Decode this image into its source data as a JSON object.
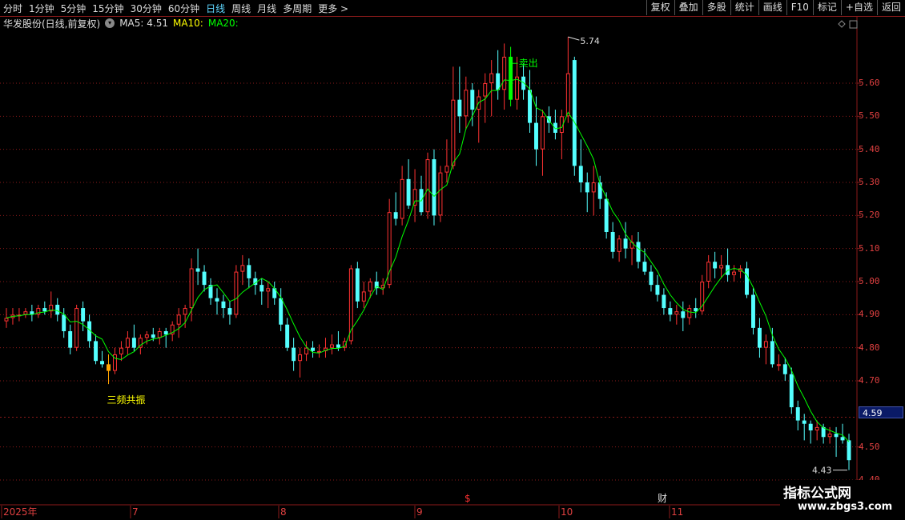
{
  "toolbar": {
    "periods": [
      "分时",
      "1分钟",
      "5分钟",
      "15分钟",
      "30分钟",
      "60分钟",
      "日线",
      "周线",
      "月线",
      "多周期",
      "更多 >"
    ],
    "active_period": "日线",
    "buttons": [
      "复权",
      "叠加",
      "多股",
      "统计",
      "画线",
      "F10",
      "标记",
      "+自选",
      "返回"
    ]
  },
  "info": {
    "stock_name": "华发股份(日线,前复权)",
    "ma5_label": "MA5: 4.51",
    "ma10_label": "MA10:",
    "ma20_label": "MA20:"
  },
  "price_axis": {
    "ticks": [
      "5.60",
      "5.50",
      "5.40",
      "5.30",
      "5.20",
      "5.10",
      "5.00",
      "4.90",
      "4.80",
      "4.70",
      "4.50",
      "4.40"
    ]
  },
  "current_price": "4.59",
  "time_axis": {
    "labels": [
      "2025年",
      "7",
      "8",
      "9",
      "10",
      "11"
    ],
    "event_markers": [
      "$",
      "财"
    ]
  },
  "annotations": {
    "high_label": "5.74",
    "low_label": "4.43",
    "buy_signal": "三频共振",
    "sell_signal": "卖出"
  },
  "watermark": {
    "line1": "指标公式网",
    "line2": "www.zbgs3.com"
  },
  "colors": {
    "up": "#ff3232",
    "down": "#54ffff",
    "ma": "#00ff00",
    "grid": "#8b1a1a",
    "signal_buy": "#ffa500",
    "signal_sell": "#00ff00"
  },
  "chart_data": {
    "type": "candlestick",
    "y_range": [
      4.4,
      5.75
    ],
    "series": [
      {
        "name": "candles",
        "values": [
          [
            4.88,
            4.92,
            4.86,
            4.89
          ],
          [
            4.89,
            4.92,
            4.87,
            4.9
          ],
          [
            4.9,
            4.92,
            4.88,
            4.9
          ],
          [
            4.9,
            4.92,
            4.89,
            4.91
          ],
          [
            4.91,
            4.93,
            4.88,
            4.9
          ],
          [
            4.9,
            4.93,
            4.89,
            4.92
          ],
          [
            4.92,
            4.94,
            4.9,
            4.91
          ],
          [
            4.91,
            4.97,
            4.89,
            4.93
          ],
          [
            4.93,
            4.95,
            4.88,
            4.9
          ],
          [
            4.9,
            4.92,
            4.83,
            4.85
          ],
          [
            4.85,
            4.87,
            4.78,
            4.8
          ],
          [
            4.8,
            4.93,
            4.79,
            4.92
          ],
          [
            4.92,
            4.94,
            4.85,
            4.88
          ],
          [
            4.88,
            4.9,
            4.8,
            4.82
          ],
          [
            4.82,
            4.84,
            4.75,
            4.76
          ],
          [
            4.76,
            4.79,
            4.74,
            4.75
          ],
          [
            4.75,
            4.78,
            4.69,
            4.73
          ],
          [
            4.73,
            4.8,
            4.72,
            4.78
          ],
          [
            4.78,
            4.82,
            4.76,
            4.8
          ],
          [
            4.8,
            4.85,
            4.78,
            4.83
          ],
          [
            4.83,
            4.87,
            4.79,
            4.8
          ],
          [
            4.8,
            4.84,
            4.78,
            4.83
          ],
          [
            4.83,
            4.85,
            4.81,
            4.84
          ],
          [
            4.84,
            4.86,
            4.82,
            4.83
          ],
          [
            4.83,
            4.86,
            4.81,
            4.85
          ],
          [
            4.85,
            4.86,
            4.8,
            4.84
          ],
          [
            4.84,
            4.88,
            4.82,
            4.87
          ],
          [
            4.87,
            4.92,
            4.83,
            4.9
          ],
          [
            4.9,
            4.93,
            4.86,
            4.92
          ],
          [
            4.92,
            5.07,
            4.88,
            5.04
          ],
          [
            5.04,
            5.1,
            4.99,
            5.03
          ],
          [
            5.03,
            5.05,
            4.97,
            4.99
          ],
          [
            4.99,
            5.01,
            4.93,
            4.95
          ],
          [
            4.95,
            4.98,
            4.9,
            4.94
          ],
          [
            4.94,
            4.96,
            4.89,
            4.92
          ],
          [
            4.92,
            4.94,
            4.87,
            4.9
          ],
          [
            4.9,
            5.05,
            4.89,
            5.03
          ],
          [
            5.03,
            5.08,
            4.99,
            5.05
          ],
          [
            5.05,
            5.07,
            4.98,
            5.01
          ],
          [
            5.01,
            5.03,
            4.96,
            4.99
          ],
          [
            4.99,
            5.01,
            4.93,
            4.97
          ],
          [
            4.97,
            5.0,
            4.92,
            4.98
          ],
          [
            4.98,
            5.0,
            4.93,
            4.95
          ],
          [
            4.95,
            4.98,
            4.85,
            4.87
          ],
          [
            4.87,
            4.89,
            4.79,
            4.8
          ],
          [
            4.8,
            4.83,
            4.73,
            4.76
          ],
          [
            4.76,
            4.8,
            4.71,
            4.78
          ],
          [
            4.78,
            4.82,
            4.76,
            4.8
          ],
          [
            4.8,
            4.82,
            4.77,
            4.79
          ],
          [
            4.79,
            4.81,
            4.77,
            4.79
          ],
          [
            4.79,
            4.83,
            4.77,
            4.8
          ],
          [
            4.8,
            4.84,
            4.78,
            4.81
          ],
          [
            4.81,
            4.85,
            4.79,
            4.8
          ],
          [
            4.8,
            4.83,
            4.79,
            4.82
          ],
          [
            4.82,
            5.05,
            4.81,
            5.04
          ],
          [
            5.04,
            5.06,
            4.92,
            4.94
          ],
          [
            4.94,
            5.0,
            4.92,
            4.97
          ],
          [
            4.97,
            5.01,
            4.95,
            5.0
          ],
          [
            5.0,
            5.03,
            4.96,
            4.98
          ],
          [
            4.98,
            5.01,
            4.96,
            4.99
          ],
          [
            4.99,
            5.25,
            4.98,
            5.21
          ],
          [
            5.21,
            5.27,
            5.17,
            5.19
          ],
          [
            5.19,
            5.35,
            5.17,
            5.31
          ],
          [
            5.31,
            5.37,
            5.22,
            5.23
          ],
          [
            5.23,
            5.34,
            5.18,
            5.28
          ],
          [
            5.28,
            5.32,
            5.2,
            5.21
          ],
          [
            5.21,
            5.39,
            5.19,
            5.37
          ],
          [
            5.37,
            5.4,
            5.17,
            5.2
          ],
          [
            5.2,
            5.35,
            5.18,
            5.33
          ],
          [
            5.33,
            5.43,
            5.3,
            5.35
          ],
          [
            5.35,
            5.65,
            5.34,
            5.55
          ],
          [
            5.55,
            5.65,
            5.45,
            5.5
          ],
          [
            5.5,
            5.62,
            5.46,
            5.58
          ],
          [
            5.58,
            5.6,
            5.47,
            5.52
          ],
          [
            5.52,
            5.58,
            5.42,
            5.56
          ],
          [
            5.56,
            5.63,
            5.48,
            5.6
          ],
          [
            5.6,
            5.67,
            5.5,
            5.63
          ],
          [
            5.63,
            5.7,
            5.55,
            5.58
          ],
          [
            5.58,
            5.72,
            5.52,
            5.68
          ],
          [
            5.68,
            5.71,
            5.53,
            5.55
          ],
          [
            5.55,
            5.68,
            5.52,
            5.62
          ],
          [
            5.62,
            5.66,
            5.55,
            5.58
          ],
          [
            5.58,
            5.64,
            5.45,
            5.48
          ],
          [
            5.48,
            5.56,
            5.35,
            5.4
          ],
          [
            5.4,
            5.52,
            5.32,
            5.5
          ],
          [
            5.5,
            5.53,
            5.45,
            5.48
          ],
          [
            5.48,
            5.52,
            5.43,
            5.45
          ],
          [
            5.45,
            5.52,
            5.37,
            5.5
          ],
          [
            5.5,
            5.74,
            5.48,
            5.63
          ],
          [
            5.67,
            5.68,
            5.32,
            5.35
          ],
          [
            5.35,
            5.43,
            5.27,
            5.3
          ],
          [
            5.3,
            5.33,
            5.21,
            5.27
          ],
          [
            5.27,
            5.35,
            5.2,
            5.3
          ],
          [
            5.3,
            5.32,
            5.22,
            5.25
          ],
          [
            5.25,
            5.27,
            5.13,
            5.15
          ],
          [
            5.15,
            5.18,
            5.07,
            5.09
          ],
          [
            5.09,
            5.14,
            5.06,
            5.13
          ],
          [
            5.13,
            5.18,
            5.07,
            5.1
          ],
          [
            5.1,
            5.14,
            5.05,
            5.12
          ],
          [
            5.12,
            5.15,
            5.04,
            5.06
          ],
          [
            5.06,
            5.1,
            5.02,
            5.03
          ],
          [
            5.03,
            5.05,
            4.97,
            4.99
          ],
          [
            4.99,
            5.02,
            4.94,
            4.96
          ],
          [
            4.96,
            4.98,
            4.9,
            4.92
          ],
          [
            4.92,
            4.94,
            4.88,
            4.9
          ],
          [
            4.9,
            4.93,
            4.87,
            4.91
          ],
          [
            4.91,
            4.94,
            4.85,
            4.89
          ],
          [
            4.89,
            4.93,
            4.87,
            4.92
          ],
          [
            4.92,
            4.95,
            4.89,
            4.91
          ],
          [
            4.91,
            5.02,
            4.9,
            5.0
          ],
          [
            5.0,
            5.08,
            4.98,
            5.06
          ],
          [
            5.06,
            5.09,
            5.01,
            5.04
          ],
          [
            5.04,
            5.08,
            5.01,
            5.05
          ],
          [
            5.05,
            5.1,
            5.0,
            5.02
          ],
          [
            5.02,
            5.05,
            5.0,
            5.03
          ],
          [
            5.03,
            5.05,
            5.01,
            5.04
          ],
          [
            5.04,
            5.06,
            4.95,
            4.96
          ],
          [
            4.96,
            4.98,
            4.84,
            4.86
          ],
          [
            4.86,
            4.89,
            4.77,
            4.8
          ],
          [
            4.8,
            4.84,
            4.75,
            4.82
          ],
          [
            4.82,
            4.86,
            4.74,
            4.75
          ],
          [
            4.75,
            4.78,
            4.73,
            4.75
          ],
          [
            4.75,
            4.77,
            4.7,
            4.72
          ],
          [
            4.72,
            4.74,
            4.6,
            4.62
          ],
          [
            4.62,
            4.64,
            4.55,
            4.58
          ],
          [
            4.58,
            4.6,
            4.52,
            4.57
          ],
          [
            4.57,
            4.58,
            4.51,
            4.55
          ],
          [
            4.55,
            4.58,
            4.52,
            4.56
          ],
          [
            4.56,
            4.57,
            4.51,
            4.53
          ],
          [
            4.53,
            4.56,
            4.51,
            4.54
          ],
          [
            4.54,
            4.56,
            4.47,
            4.53
          ],
          [
            4.53,
            4.57,
            4.51,
            4.52
          ],
          [
            4.52,
            4.54,
            4.43,
            4.46
          ]
        ]
      }
    ]
  }
}
